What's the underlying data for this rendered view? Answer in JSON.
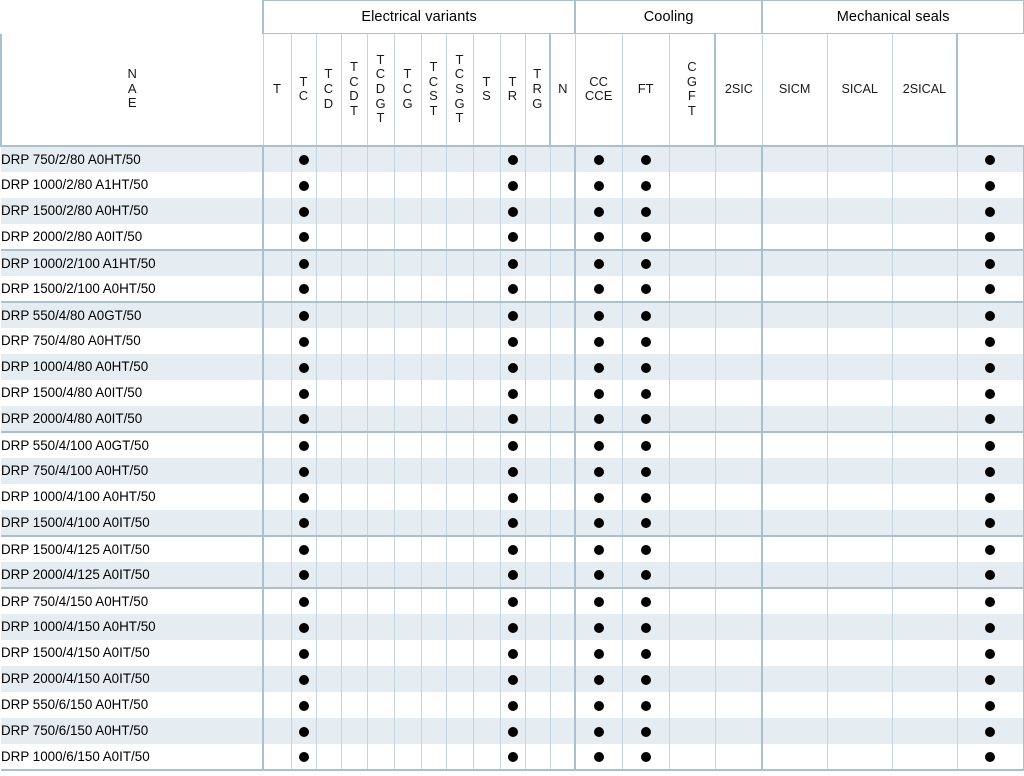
{
  "table": {
    "corner_label": "",
    "groups": [
      {
        "id": "electrical",
        "label": "Electrical variants",
        "span": 12
      },
      {
        "id": "cooling",
        "label": "Cooling",
        "span": 4
      },
      {
        "id": "seals",
        "label": "Mechanical seals",
        "span": 4
      }
    ],
    "columns": [
      {
        "group": "electrical",
        "id": "nae",
        "label": "N\nA\nE",
        "orientation": "stacked"
      },
      {
        "group": "electrical",
        "id": "t",
        "label": "T",
        "orientation": "stacked"
      },
      {
        "group": "electrical",
        "id": "tc",
        "label": "T\nC",
        "orientation": "stacked"
      },
      {
        "group": "electrical",
        "id": "tcd",
        "label": "T\nC\nD",
        "orientation": "stacked"
      },
      {
        "group": "electrical",
        "id": "tcdt",
        "label": "T\nC\nD\nT",
        "orientation": "stacked"
      },
      {
        "group": "electrical",
        "id": "tcdgt",
        "label": "T\nC\nD\nG\nT",
        "orientation": "stacked"
      },
      {
        "group": "electrical",
        "id": "tcg",
        "label": "T\nC\nG",
        "orientation": "stacked"
      },
      {
        "group": "electrical",
        "id": "tcst",
        "label": "T\nC\nS\nT",
        "orientation": "stacked"
      },
      {
        "group": "electrical",
        "id": "tcsgt",
        "label": "T\nC\nS\nG\nT",
        "orientation": "stacked"
      },
      {
        "group": "electrical",
        "id": "ts",
        "label": "T\nS",
        "orientation": "stacked"
      },
      {
        "group": "electrical",
        "id": "tr",
        "label": "T\nR",
        "orientation": "stacked"
      },
      {
        "group": "electrical",
        "id": "trg",
        "label": "T\nR\nG",
        "orientation": "stacked"
      },
      {
        "group": "cooling",
        "id": "n",
        "label": "N",
        "orientation": "plain"
      },
      {
        "group": "cooling",
        "id": "cc_cce",
        "label": "CC\nCCE",
        "orientation": "stacked"
      },
      {
        "group": "cooling",
        "id": "ft",
        "label": "FT",
        "orientation": "plain"
      },
      {
        "group": "cooling",
        "id": "cgft",
        "label": "C\nG\nF\nT",
        "orientation": "stacked"
      },
      {
        "group": "seals",
        "id": "2sic",
        "label": "2SIC",
        "orientation": "plain"
      },
      {
        "group": "seals",
        "id": "sicm",
        "label": "SICM",
        "orientation": "plain"
      },
      {
        "group": "seals",
        "id": "sical",
        "label": "SICAL",
        "orientation": "plain"
      },
      {
        "group": "seals",
        "id": "2sical",
        "label": "2SICAL",
        "orientation": "plain"
      }
    ],
    "rows": [
      {
        "label": "DRP 750/2/80 A0HT/50",
        "group_start": true,
        "marks": [
          0,
          1,
          0,
          0,
          0,
          0,
          0,
          0,
          0,
          1,
          0,
          0,
          1,
          1,
          0,
          0,
          0,
          0,
          0,
          1
        ]
      },
      {
        "label": "DRP 1000/2/80 A1HT/50",
        "group_start": false,
        "marks": [
          0,
          1,
          0,
          0,
          0,
          0,
          0,
          0,
          0,
          1,
          0,
          0,
          1,
          1,
          0,
          0,
          0,
          0,
          0,
          1
        ]
      },
      {
        "label": "DRP 1500/2/80 A0HT/50",
        "group_start": false,
        "marks": [
          0,
          1,
          0,
          0,
          0,
          0,
          0,
          0,
          0,
          1,
          0,
          0,
          1,
          1,
          0,
          0,
          0,
          0,
          0,
          1
        ]
      },
      {
        "label": "DRP 2000/2/80 A0IT/50",
        "group_start": false,
        "marks": [
          0,
          1,
          0,
          0,
          0,
          0,
          0,
          0,
          0,
          1,
          0,
          0,
          1,
          1,
          0,
          0,
          0,
          0,
          0,
          1
        ]
      },
      {
        "label": "DRP 1000/2/100 A1HT/50",
        "group_start": true,
        "marks": [
          0,
          1,
          0,
          0,
          0,
          0,
          0,
          0,
          0,
          1,
          0,
          0,
          1,
          1,
          0,
          0,
          0,
          0,
          0,
          1
        ]
      },
      {
        "label": "DRP 1500/2/100 A0HT/50",
        "group_start": false,
        "marks": [
          0,
          1,
          0,
          0,
          0,
          0,
          0,
          0,
          0,
          1,
          0,
          0,
          1,
          1,
          0,
          0,
          0,
          0,
          0,
          1
        ]
      },
      {
        "label": "DRP 550/4/80 A0GT/50",
        "group_start": true,
        "marks": [
          0,
          1,
          0,
          0,
          0,
          0,
          0,
          0,
          0,
          1,
          0,
          0,
          1,
          1,
          0,
          0,
          0,
          0,
          0,
          1
        ]
      },
      {
        "label": "DRP 750/4/80 A0HT/50",
        "group_start": false,
        "marks": [
          0,
          1,
          0,
          0,
          0,
          0,
          0,
          0,
          0,
          1,
          0,
          0,
          1,
          1,
          0,
          0,
          0,
          0,
          0,
          1
        ]
      },
      {
        "label": "DRP 1000/4/80 A0HT/50",
        "group_start": false,
        "marks": [
          0,
          1,
          0,
          0,
          0,
          0,
          0,
          0,
          0,
          1,
          0,
          0,
          1,
          1,
          0,
          0,
          0,
          0,
          0,
          1
        ]
      },
      {
        "label": "DRP 1500/4/80 A0IT/50",
        "group_start": false,
        "marks": [
          0,
          1,
          0,
          0,
          0,
          0,
          0,
          0,
          0,
          1,
          0,
          0,
          1,
          1,
          0,
          0,
          0,
          0,
          0,
          1
        ]
      },
      {
        "label": "DRP 2000/4/80 A0IT/50",
        "group_start": false,
        "marks": [
          0,
          1,
          0,
          0,
          0,
          0,
          0,
          0,
          0,
          1,
          0,
          0,
          1,
          1,
          0,
          0,
          0,
          0,
          0,
          1
        ]
      },
      {
        "label": "DRP 550/4/100 A0GT/50",
        "group_start": true,
        "marks": [
          0,
          1,
          0,
          0,
          0,
          0,
          0,
          0,
          0,
          1,
          0,
          0,
          1,
          1,
          0,
          0,
          0,
          0,
          0,
          1
        ]
      },
      {
        "label": "DRP 750/4/100 A0HT/50",
        "group_start": false,
        "marks": [
          0,
          1,
          0,
          0,
          0,
          0,
          0,
          0,
          0,
          1,
          0,
          0,
          1,
          1,
          0,
          0,
          0,
          0,
          0,
          1
        ]
      },
      {
        "label": "DRP 1000/4/100 A0HT/50",
        "group_start": false,
        "marks": [
          0,
          1,
          0,
          0,
          0,
          0,
          0,
          0,
          0,
          1,
          0,
          0,
          1,
          1,
          0,
          0,
          0,
          0,
          0,
          1
        ]
      },
      {
        "label": "DRP 1500/4/100 A0IT/50",
        "group_start": false,
        "marks": [
          0,
          1,
          0,
          0,
          0,
          0,
          0,
          0,
          0,
          1,
          0,
          0,
          1,
          1,
          0,
          0,
          0,
          0,
          0,
          1
        ]
      },
      {
        "label": "DRP 1500/4/125 A0IT/50",
        "group_start": true,
        "marks": [
          0,
          1,
          0,
          0,
          0,
          0,
          0,
          0,
          0,
          1,
          0,
          0,
          1,
          1,
          0,
          0,
          0,
          0,
          0,
          1
        ]
      },
      {
        "label": "DRP 2000/4/125 A0IT/50",
        "group_start": false,
        "marks": [
          0,
          1,
          0,
          0,
          0,
          0,
          0,
          0,
          0,
          1,
          0,
          0,
          1,
          1,
          0,
          0,
          0,
          0,
          0,
          1
        ]
      },
      {
        "label": "DRP 750/4/150 A0HT/50",
        "group_start": true,
        "marks": [
          0,
          1,
          0,
          0,
          0,
          0,
          0,
          0,
          0,
          1,
          0,
          0,
          1,
          1,
          0,
          0,
          0,
          0,
          0,
          1
        ]
      },
      {
        "label": "DRP 1000/4/150 A0HT/50",
        "group_start": false,
        "marks": [
          0,
          1,
          0,
          0,
          0,
          0,
          0,
          0,
          0,
          1,
          0,
          0,
          1,
          1,
          0,
          0,
          0,
          0,
          0,
          1
        ]
      },
      {
        "label": "DRP 1500/4/150 A0IT/50",
        "group_start": false,
        "marks": [
          0,
          1,
          0,
          0,
          0,
          0,
          0,
          0,
          0,
          1,
          0,
          0,
          1,
          1,
          0,
          0,
          0,
          0,
          0,
          1
        ]
      },
      {
        "label": "DRP 2000/4/150 A0IT/50",
        "group_start": false,
        "marks": [
          0,
          1,
          0,
          0,
          0,
          0,
          0,
          0,
          0,
          1,
          0,
          0,
          1,
          1,
          0,
          0,
          0,
          0,
          0,
          1
        ]
      },
      {
        "label": "DRP 550/6/150 A0HT/50",
        "group_start": false,
        "marks": [
          0,
          1,
          0,
          0,
          0,
          0,
          0,
          0,
          0,
          1,
          0,
          0,
          1,
          1,
          0,
          0,
          0,
          0,
          0,
          1
        ]
      },
      {
        "label": "DRP 750/6/150 A0HT/50",
        "group_start": false,
        "marks": [
          0,
          1,
          0,
          0,
          0,
          0,
          0,
          0,
          0,
          1,
          0,
          0,
          1,
          1,
          0,
          0,
          0,
          0,
          0,
          1
        ]
      },
      {
        "label": "DRP 1000/6/150 A0IT/50",
        "group_start": false,
        "marks": [
          0,
          1,
          0,
          0,
          0,
          0,
          0,
          0,
          0,
          1,
          0,
          0,
          1,
          1,
          0,
          0,
          0,
          0,
          0,
          1
        ]
      }
    ],
    "colors": {
      "grid_line": "#c3d5e0",
      "group_line": "#a9c0cf",
      "stripe": "#e5edf2",
      "plain": "#ffffff",
      "dot": "#000000",
      "text": "#1a1a1a"
    },
    "column_widths": {
      "label": 262,
      "electrical": [
        28,
        25,
        25,
        26,
        27,
        27,
        25,
        27,
        27,
        25,
        25,
        25
      ],
      "cooling": [
        47,
        47,
        46,
        47
      ],
      "seals": [
        65,
        65,
        65,
        67
      ]
    }
  }
}
